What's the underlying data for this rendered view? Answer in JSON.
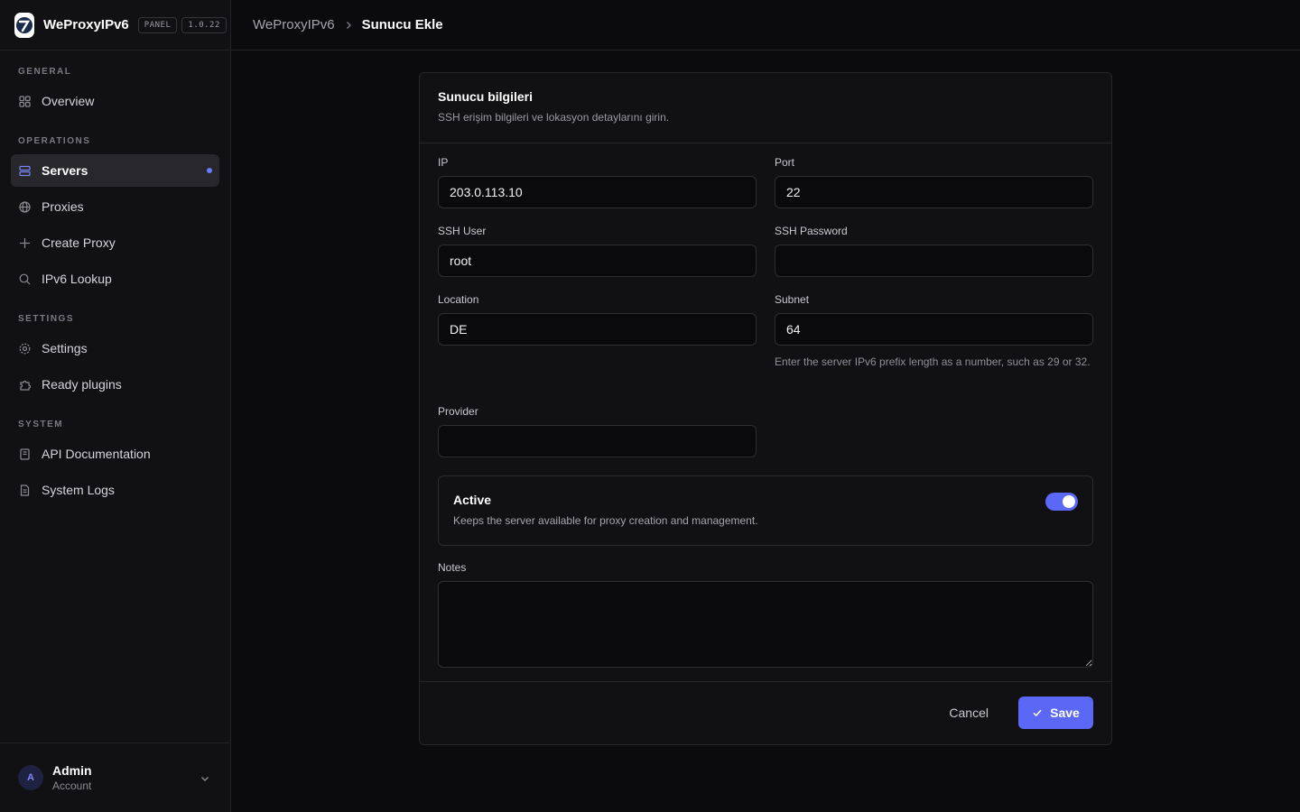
{
  "brand": {
    "name": "WeProxyIPv6",
    "badge": "PANEL",
    "version": "1.0.22"
  },
  "breadcrumb": {
    "root": "WeProxyIPv6",
    "current": "Sunucu Ekle"
  },
  "sidebar": {
    "sections": [
      {
        "title": "GENERAL",
        "items": [
          {
            "label": "Overview",
            "icon": "grid-icon"
          }
        ]
      },
      {
        "title": "OPERATIONS",
        "items": [
          {
            "label": "Servers",
            "icon": "server-icon",
            "active": true
          },
          {
            "label": "Proxies",
            "icon": "globe-icon"
          },
          {
            "label": "Create Proxy",
            "icon": "plus-icon"
          },
          {
            "label": "IPv6 Lookup",
            "icon": "search-icon"
          }
        ]
      },
      {
        "title": "SETTINGS",
        "items": [
          {
            "label": "Settings",
            "icon": "gear-icon"
          },
          {
            "label": "Ready plugins",
            "icon": "puzzle-icon"
          }
        ]
      },
      {
        "title": "SYSTEM",
        "items": [
          {
            "label": "API Documentation",
            "icon": "book-icon"
          },
          {
            "label": "System Logs",
            "icon": "file-icon"
          }
        ]
      }
    ]
  },
  "user": {
    "initial": "A",
    "name": "Admin",
    "role": "Account"
  },
  "form": {
    "title": "Sunucu bilgileri",
    "subtitle": "SSH erişim bilgileri ve lokasyon detaylarını girin.",
    "ip": {
      "label": "IP",
      "value": "203.0.113.10"
    },
    "port": {
      "label": "Port",
      "value": "22"
    },
    "ssh_user": {
      "label": "SSH User",
      "value": "root"
    },
    "ssh_password": {
      "label": "SSH Password",
      "value": ""
    },
    "location": {
      "label": "Location",
      "value": "DE"
    },
    "subnet": {
      "label": "Subnet",
      "value": "64",
      "hint": "Enter the server IPv6 prefix length as a number, such as 29 or 32."
    },
    "provider": {
      "label": "Provider",
      "value": ""
    },
    "active": {
      "title": "Active",
      "description": "Keeps the server available for proxy creation and management.",
      "enabled": true
    },
    "notes": {
      "label": "Notes",
      "value": ""
    },
    "cancel_label": "Cancel",
    "save_label": "Save"
  },
  "colors": {
    "accent": "#5b68f5",
    "background": "#0b0b0d",
    "surface": "#111113"
  }
}
